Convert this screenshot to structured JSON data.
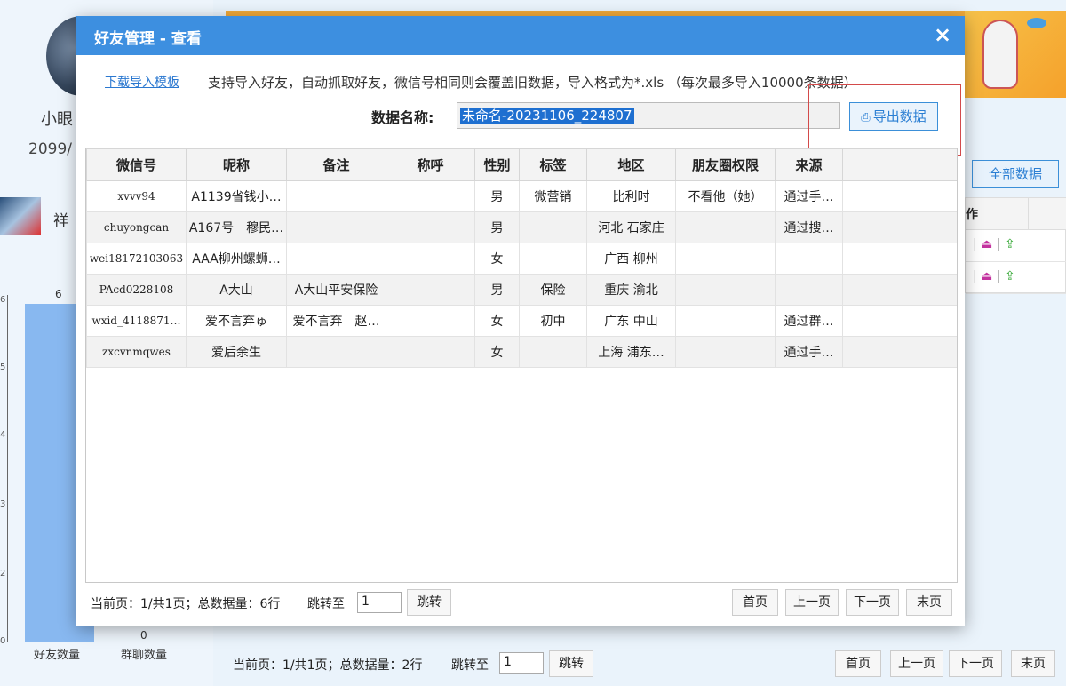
{
  "background": {
    "profile_name": "小眼",
    "profile_date": "2099/",
    "contact_name": "祥",
    "chart": {
      "y_ticks": [
        "6",
        "5",
        "4",
        "3",
        "2",
        "1",
        "0"
      ],
      "bar_values": [
        "6",
        "0"
      ],
      "x_labels": [
        "好友数量",
        "群聊数量"
      ]
    },
    "all_data_button": "全部数据",
    "table_header_fragment": "作",
    "pager": {
      "info": "当前页：1/共1页；总数据量：2行",
      "jump_label": "跳转至",
      "jump_value": "1",
      "jump_button": "跳转",
      "first": "首页",
      "prev": "上一页",
      "next": "下一页",
      "last": "末页"
    }
  },
  "modal": {
    "title": "好友管理 - 查看",
    "close": "×",
    "template_link": "下载导入模板",
    "import_desc": "支持导入好友，自动抓取好友，微信号相同则会覆盖旧数据，导入格式为*.xls （每次最多导入10000条数据）",
    "data_name_label": "数据名称:",
    "data_name_value": "未命名-20231106_224807",
    "export_button": "导出数据",
    "columns": [
      "微信号",
      "昵称",
      "备注",
      "称呼",
      "性别",
      "标签",
      "地区",
      "朋友圈权限",
      "来源",
      ""
    ],
    "rows": [
      {
        "wxid": "xvvv94",
        "nickname": "A1139省钱小…",
        "remark": "",
        "title": "",
        "gender": "男",
        "tag": "微营销",
        "region": "比利时",
        "moments": "不看他（她）",
        "source": "通过手…"
      },
      {
        "wxid": "chuyongcan",
        "nickname": "A167号　穆民…",
        "remark": "",
        "title": "",
        "gender": "男",
        "tag": "",
        "region": "河北 石家庄",
        "moments": "",
        "source": "通过搜…"
      },
      {
        "wxid": "wei18172103063",
        "nickname": "AAA柳州螺蛳…",
        "remark": "",
        "title": "",
        "gender": "女",
        "tag": "",
        "region": "广西 柳州",
        "moments": "",
        "source": ""
      },
      {
        "wxid": "PAcd0228108",
        "nickname": "A大山",
        "remark": "A大山平安保险",
        "title": "",
        "gender": "男",
        "tag": "保险",
        "region": "重庆 渝北",
        "moments": "",
        "source": ""
      },
      {
        "wxid": "wxid_4118871…",
        "nickname": "爱不言弃ゅ",
        "remark": "爱不言弃　赵…",
        "title": "",
        "gender": "女",
        "tag": "初中",
        "region": "广东 中山",
        "moments": "",
        "source": "通过群…"
      },
      {
        "wxid": "zxcvnmqwes",
        "nickname": "爱后余生",
        "remark": "",
        "title": "",
        "gender": "女",
        "tag": "",
        "region": "上海 浦东…",
        "moments": "",
        "source": "通过手…"
      }
    ],
    "pager": {
      "info": "当前页：1/共1页；总数据量：6行",
      "jump_label": "跳转至",
      "jump_value": "1",
      "jump_button": "跳转",
      "first": "首页",
      "prev": "上一页",
      "next": "下一页",
      "last": "末页"
    }
  },
  "colors": {
    "title_bar": "#3d8fe0",
    "link": "#2b78d0",
    "selection": "#1e6fd0",
    "highlight_box": "#d34a4a"
  }
}
